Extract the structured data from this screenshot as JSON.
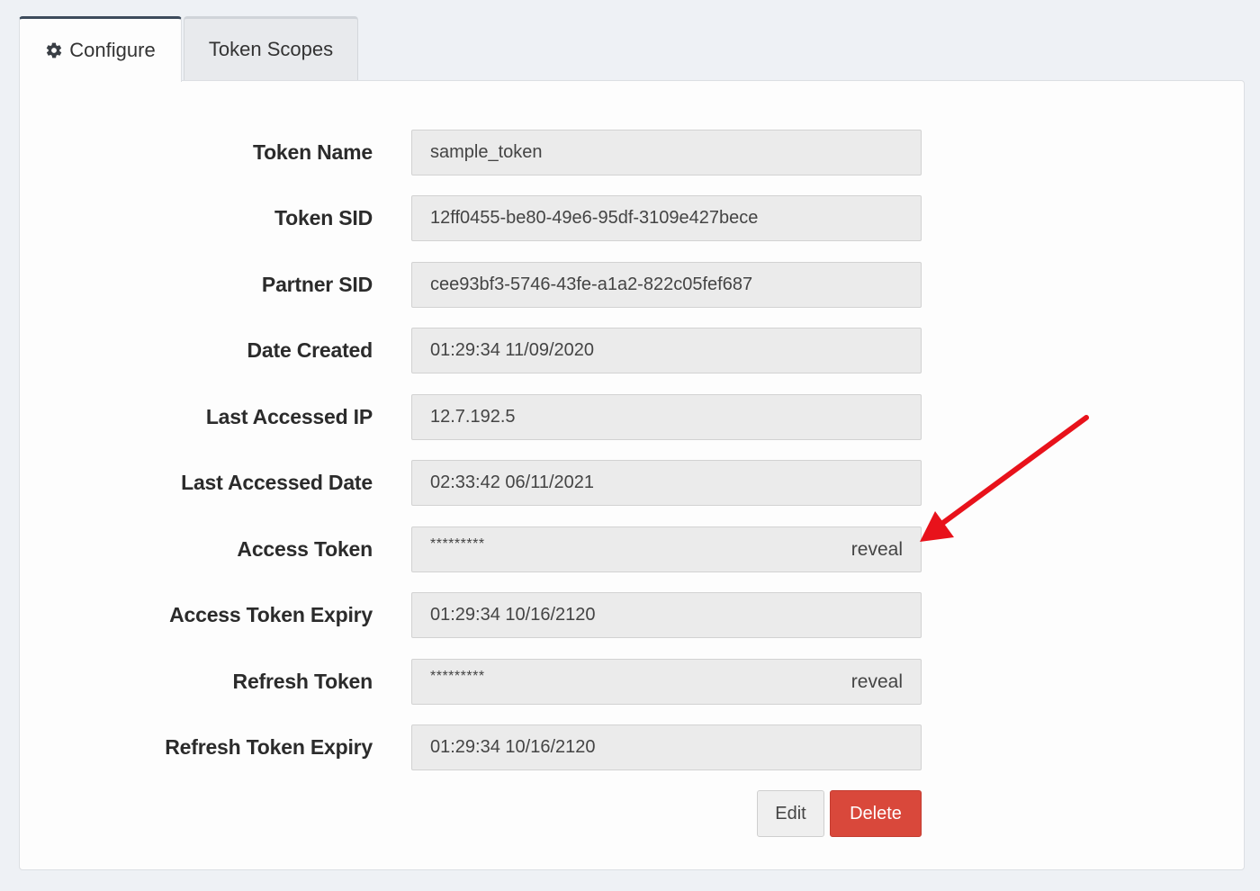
{
  "tabs": {
    "configure": {
      "label": "Configure",
      "icon": "gear-icon"
    },
    "token_scopes": {
      "label": "Token Scopes"
    }
  },
  "fields": [
    {
      "label": "Token Name",
      "value": "sample_token"
    },
    {
      "label": "Token SID",
      "value": "12ff0455-be80-49e6-95df-3109e427bece"
    },
    {
      "label": "Partner SID",
      "value": "cee93bf3-5746-43fe-a1a2-822c05fef687"
    },
    {
      "label": "Date Created",
      "value": "01:29:34 11/09/2020"
    },
    {
      "label": "Last Accessed IP",
      "value": "12.7.192.5"
    },
    {
      "label": "Last Accessed Date",
      "value": "02:33:42 06/11/2021"
    },
    {
      "label": "Access Token",
      "value": "*********",
      "reveal_label": "reveal"
    },
    {
      "label": "Access Token Expiry",
      "value": "01:29:34 10/16/2120"
    },
    {
      "label": "Refresh Token",
      "value": "*********",
      "reveal_label": "reveal"
    },
    {
      "label": "Refresh Token Expiry",
      "value": "01:29:34 10/16/2120"
    }
  ],
  "actions": {
    "edit_label": "Edit",
    "delete_label": "Delete"
  },
  "colors": {
    "delete": "#d9483b",
    "annotation_arrow": "#e8121b",
    "active_tab_border": "#3d4b5c"
  }
}
